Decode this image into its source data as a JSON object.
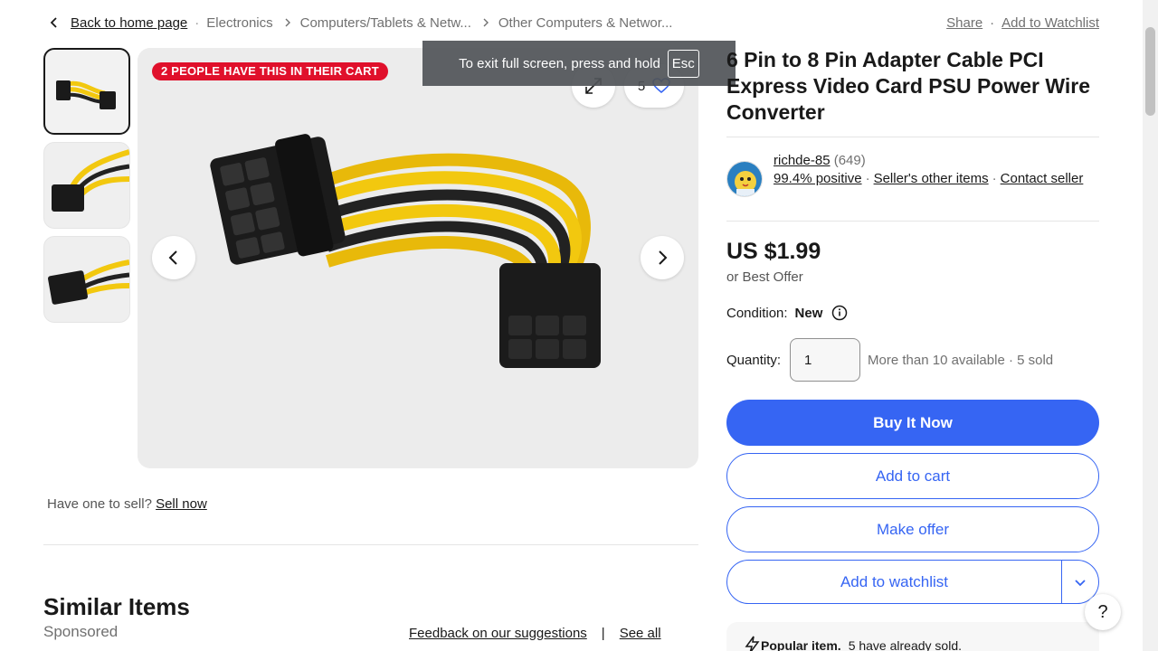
{
  "breadcrumb": {
    "back": "Back to home page",
    "crumbs": [
      "Electronics",
      "Computers/Tablets & Netw...",
      "Other Computers & Networ..."
    ]
  },
  "top_actions": {
    "share": "Share",
    "watchlist": "Add to Watchlist"
  },
  "image": {
    "cart_badge": "2 PEOPLE HAVE THIS IN THEIR CART",
    "watch_count": "5"
  },
  "fullscreen_toast": {
    "message": "To exit full screen, press and hold",
    "key": "Esc"
  },
  "sell": {
    "question": "Have one to sell?",
    "link": "Sell now"
  },
  "similar": {
    "title": "Similar Items",
    "sponsored": "Sponsored",
    "feedback": "Feedback on our suggestions",
    "separator": "|",
    "see_all": "See all"
  },
  "product": {
    "title": "6 Pin to 8 Pin Adapter Cable PCI Express Video Card PSU Power Wire Converter",
    "price": "US $1.99",
    "best_offer": "or Best Offer",
    "condition_label": "Condition:",
    "condition_value": "New",
    "quantity_label": "Quantity:",
    "quantity_value": "1",
    "availability": "More than 10 available · 5 sold"
  },
  "seller": {
    "name": "richde-85",
    "count": "(649)",
    "feedback": "99.4% positive",
    "other_items": "Seller's other items",
    "contact": "Contact seller"
  },
  "buttons": {
    "buy_now": "Buy It Now",
    "add_to_cart": "Add to cart",
    "make_offer": "Make offer",
    "add_to_watchlist": "Add to watchlist"
  },
  "popular": {
    "title": "Popular item.",
    "text": "5 have already sold."
  },
  "help": "?",
  "colors": {
    "accent": "#3665f3",
    "badge": "#e0102b",
    "cable_yellow": "#f2c80f"
  }
}
